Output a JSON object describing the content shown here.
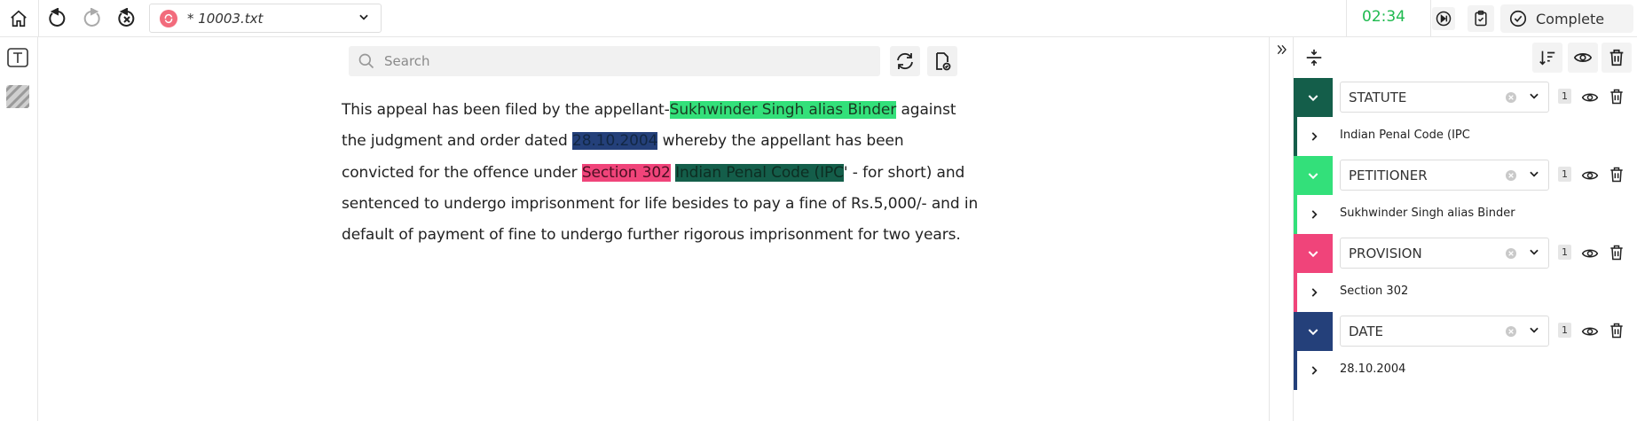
{
  "topbar": {
    "file_name": "* 10003.txt",
    "timer": "02:34",
    "complete_label": "Complete"
  },
  "search": {
    "placeholder": "Search"
  },
  "document": {
    "segments": [
      {
        "text": "This appeal has been filed by the appellant-",
        "tag": null
      },
      {
        "text": "Sukhwinder Singh alias Binder",
        "tag": "PETITIONER"
      },
      {
        "text": " against the judgment and order dated ",
        "tag": null
      },
      {
        "text": "28.10.2004",
        "tag": "DATE"
      },
      {
        "text": " whereby the appellant has been convicted for the offence under ",
        "tag": null
      },
      {
        "text": "Section 302",
        "tag": "PROVISION"
      },
      {
        "text": " ",
        "tag": null
      },
      {
        "text": "Indian Penal Code (IPC",
        "tag": "STATUTE"
      },
      {
        "text": "' - for short) and sentenced to undergo imprisonment for life besides to pay a fine of Rs.5,000/- and in default of payment of fine to undergo further rigorous imprisonment for two years.",
        "tag": null
      }
    ]
  },
  "entities": [
    {
      "name": "STATUTE",
      "count": "1",
      "value": "Indian Penal Code (IPC",
      "color": "#145e4a"
    },
    {
      "name": "PETITIONER",
      "count": "1",
      "value": "Sukhwinder Singh alias Binder",
      "color": "#33e07a"
    },
    {
      "name": "PROVISION",
      "count": "1",
      "value": "Section 302",
      "color": "#f0447a"
    },
    {
      "name": "DATE",
      "count": "1",
      "value": "28.10.2004",
      "color": "#24407a"
    }
  ],
  "icons": {
    "home": "home-icon",
    "undo": "undo-icon",
    "redo": "redo-icon",
    "reset": "reset-icon",
    "text_tool": "text-tool-icon",
    "pattern_tool": "pattern-tool-icon",
    "search": "search-icon",
    "refresh": "refresh-icon",
    "doc_check": "doc-check-icon",
    "collapse": "double-chevron-right-icon",
    "expand_all": "expand-collapse-icon",
    "sort": "sort-icon",
    "eye": "eye-icon",
    "trash": "trash-icon",
    "skip": "skip-icon",
    "clipboard": "clipboard-check-icon",
    "check": "check-circle-icon"
  }
}
